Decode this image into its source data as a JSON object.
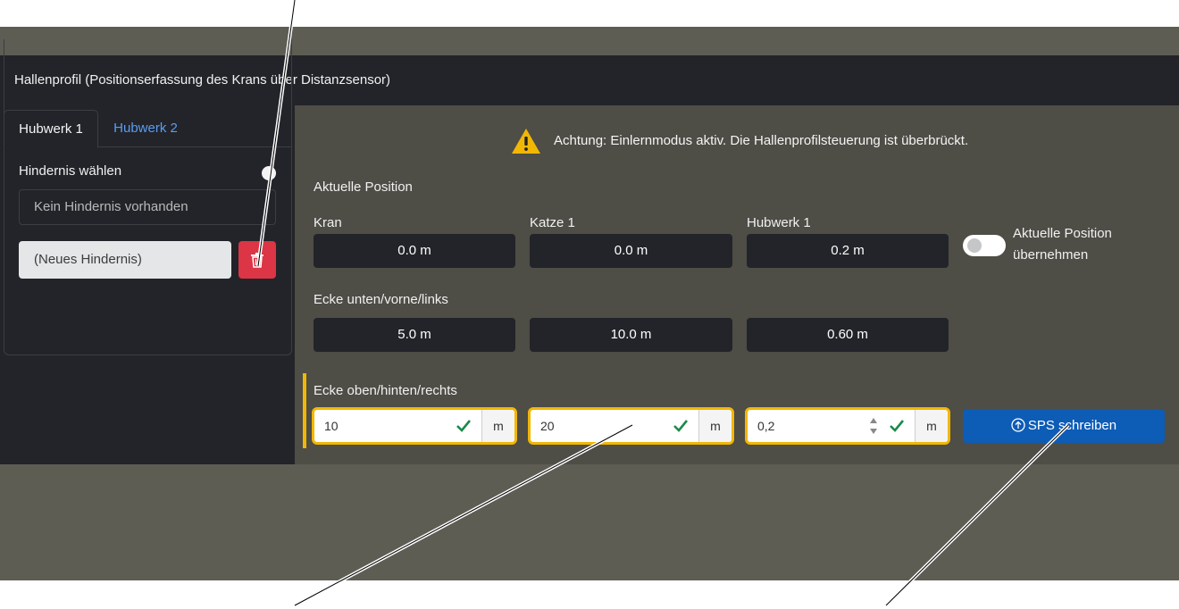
{
  "header": {
    "title": "Hallenprofil (Positionserfassung des Krans über Distanzsensor)"
  },
  "tabs": [
    {
      "label": "Hubwerk 1"
    },
    {
      "label": "Hubwerk 2"
    }
  ],
  "sidebar": {
    "select_label": "Hindernis wählen",
    "no_obstacle_text": "Kein Hindernis vorhanden",
    "new_obstacle_text": "(Neues Hindernis)"
  },
  "warning": {
    "text": "Achtung: Einlernmodus aktiv. Die Hallenprofilsteuerung ist überbrückt.",
    "icon": "warning-triangle-icon"
  },
  "current_position": {
    "section_label": "Aktuelle Position",
    "columns": [
      {
        "label": "Kran",
        "value": "0.0 m"
      },
      {
        "label": "Katze 1",
        "value": "0.0 m"
      },
      {
        "label": "Hubwerk 1",
        "value": "0.2 m"
      }
    ],
    "toggle_label_1": "Aktuelle Position",
    "toggle_label_2": "übernehmen",
    "toggle_on": false
  },
  "corner_lower": {
    "section_label": "Ecke unten/vorne/links",
    "values": [
      "5.0 m",
      "10.0 m",
      "0.60 m"
    ]
  },
  "corner_upper": {
    "section_label": "Ecke oben/hinten/rechts",
    "inputs": [
      {
        "value": "10",
        "unit": "m"
      },
      {
        "value": "20",
        "unit": "m"
      },
      {
        "value": "0,2",
        "unit": "m"
      }
    ]
  },
  "actions": {
    "write_plc_label": "SPS schreiben"
  },
  "colors": {
    "accent": "#f2b705",
    "danger": "#dc3545",
    "primary": "#0d5cb6",
    "success": "#1a8a4a"
  }
}
